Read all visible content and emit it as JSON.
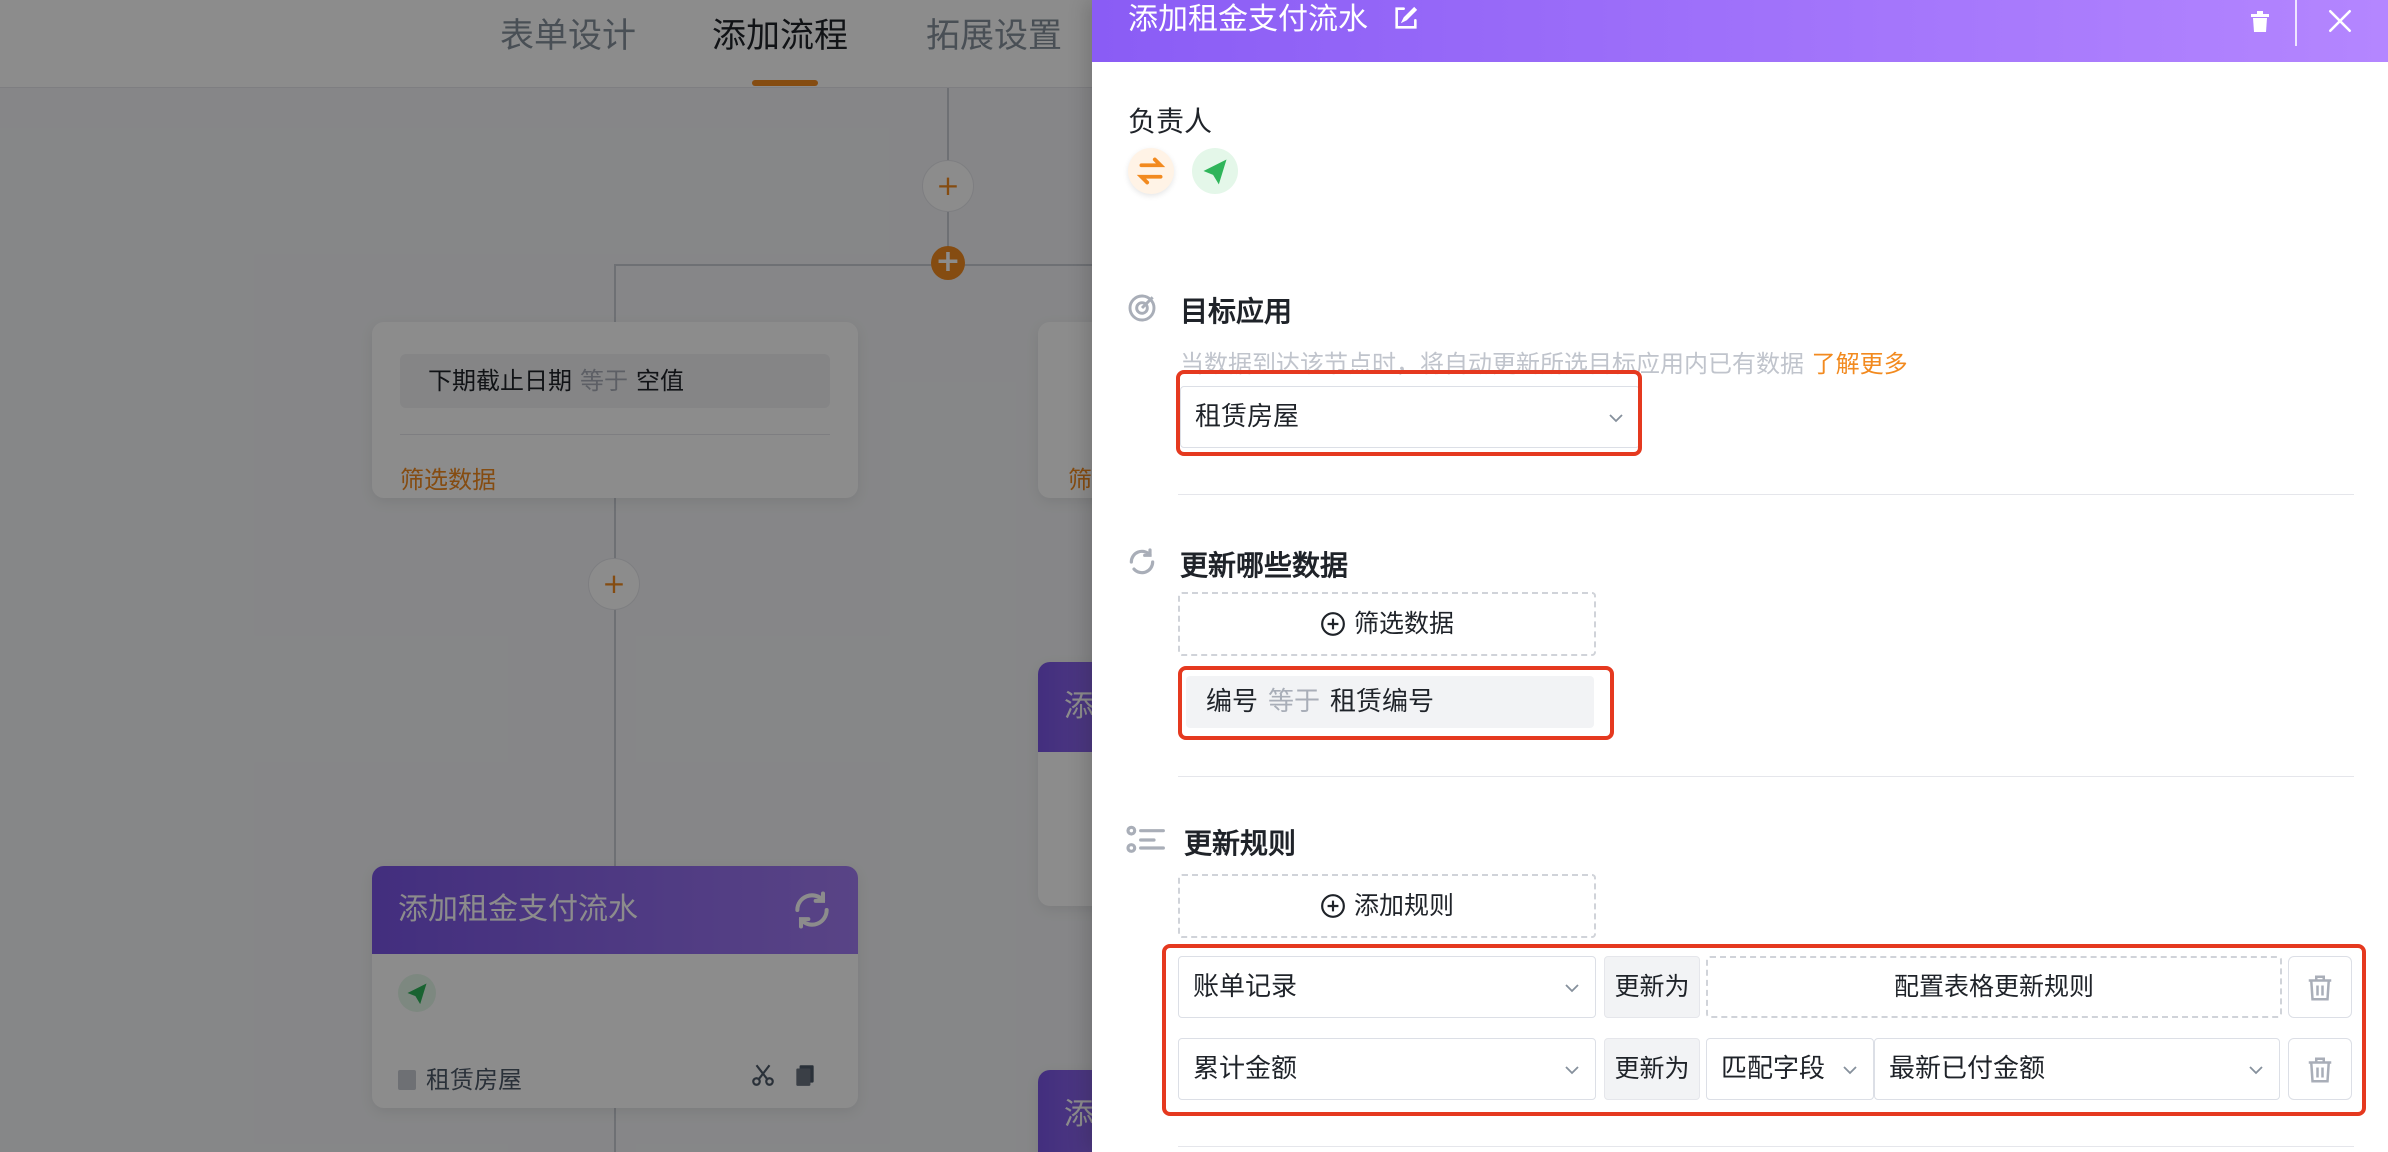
{
  "background": {
    "tabs": [
      {
        "label": "表单设计",
        "active": false
      },
      {
        "label": "添加流程",
        "active": true
      },
      {
        "label": "拓展设置",
        "active": false
      }
    ],
    "condition_card": {
      "field": "下期截止日期",
      "operator": "等于",
      "value": "空值",
      "filter_link": "筛选数据"
    },
    "partial_card_link": "筛",
    "purple_card": {
      "title": "添加租金支付流水",
      "footer_app": "租赁房屋"
    },
    "partial_purple_titles": [
      "添",
      "添"
    ]
  },
  "panel": {
    "title": "添加租金支付流水",
    "owner": {
      "label": "负责人"
    },
    "target_app": {
      "label": "目标应用",
      "hint": "当数据到达该节点时，将自动更新所选目标应用内已有数据",
      "learn_more": "了解更多",
      "selected": "租赁房屋"
    },
    "update_data": {
      "label": "更新哪些数据",
      "filter_button": "筛选数据",
      "filter": {
        "field": "编号",
        "operator": "等于",
        "value": "租赁编号"
      }
    },
    "update_rules": {
      "label": "更新规则",
      "add_button": "添加规则",
      "rules": [
        {
          "field": "账单记录",
          "action": "更新为",
          "config": "配置表格更新规则"
        },
        {
          "field": "累计金额",
          "action": "更新为",
          "mode": "匹配字段",
          "value": "最新已付金额"
        }
      ]
    }
  },
  "colors": {
    "accent": "#f28a1f",
    "header_start": "#8a5cf5",
    "header_end": "#b486ff",
    "highlight": "#e5391f"
  }
}
